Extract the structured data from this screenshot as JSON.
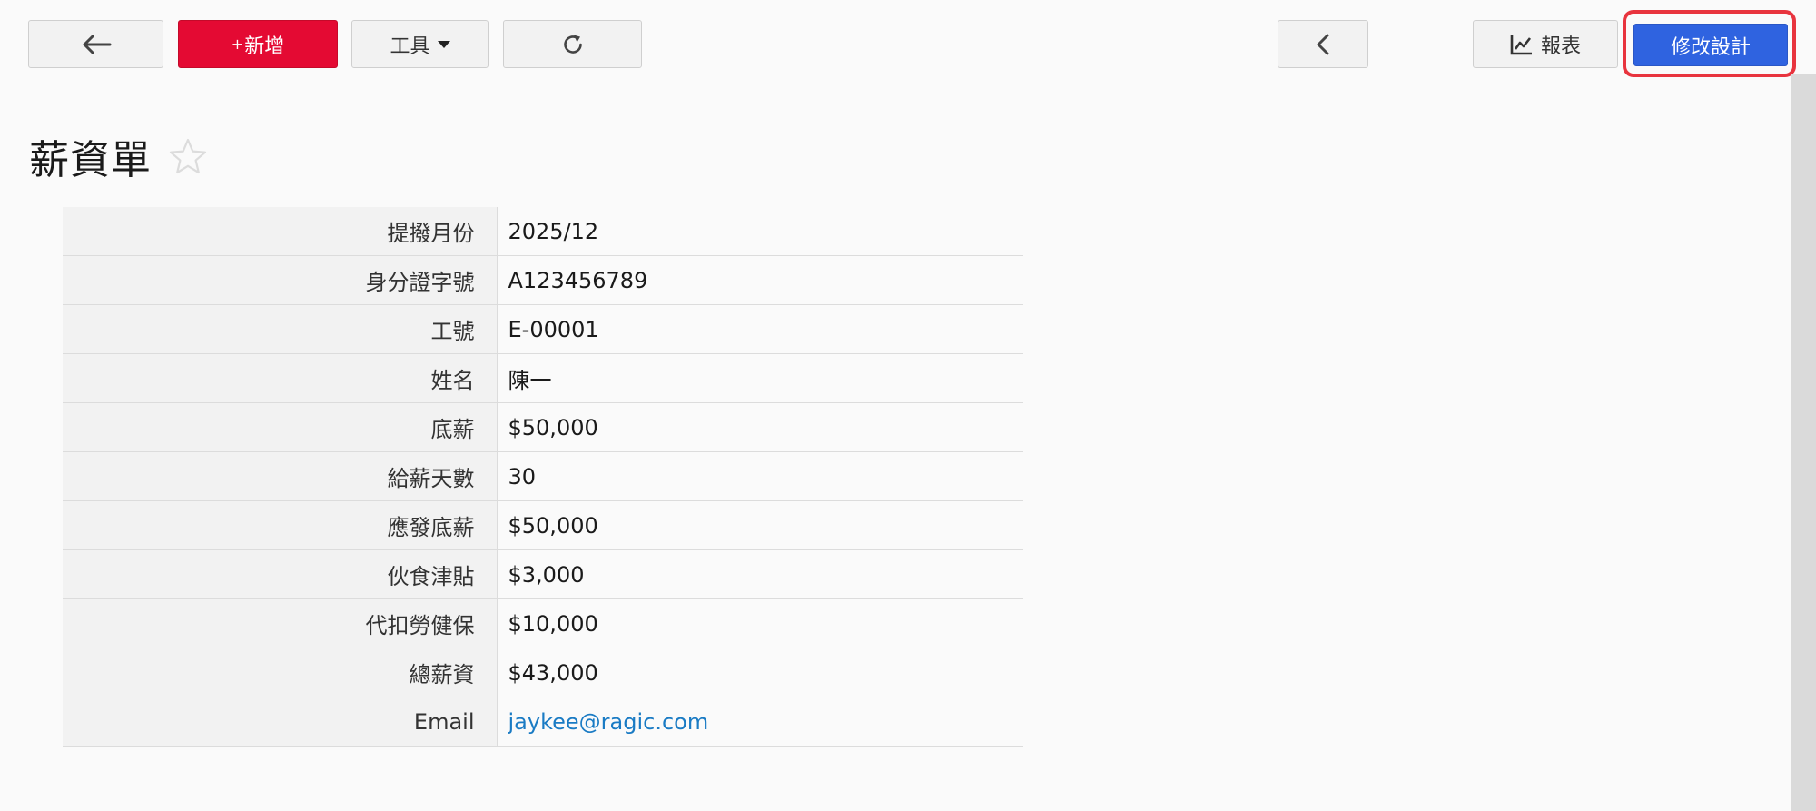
{
  "toolbar": {
    "new_plus": "+",
    "new_label": "新增",
    "tools_label": "工具",
    "report_label": "報表",
    "design_label": "修改設計"
  },
  "page": {
    "title": "薪資單"
  },
  "fields": [
    {
      "label": "提撥月份",
      "value": "2025/12"
    },
    {
      "label": "身分證字號",
      "value": "A123456789"
    },
    {
      "label": "工號",
      "value": "E-00001"
    },
    {
      "label": "姓名",
      "value": "陳一"
    },
    {
      "label": "底薪",
      "value": "$50,000"
    },
    {
      "label": "給薪天數",
      "value": "30"
    },
    {
      "label": "應發底薪",
      "value": "$50,000"
    },
    {
      "label": "伙食津貼",
      "value": "$3,000"
    },
    {
      "label": "代扣勞健保",
      "value": "$10,000"
    },
    {
      "label": "總薪資",
      "value": "$43,000"
    },
    {
      "label": "Email",
      "value": "jaykee@ragic.com"
    }
  ],
  "colors": {
    "new_button": "#e40a33",
    "design_button": "#2f63e0",
    "highlight_outline": "#e8343e",
    "link": "#1a7bc4"
  }
}
